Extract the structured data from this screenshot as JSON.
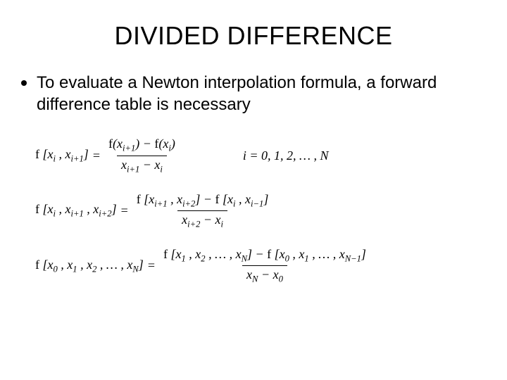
{
  "title": "DIVIDED DIFFERENCE",
  "bullet": "To evaluate a Newton interpolation formula, a forward difference table is necessary",
  "formulas": {
    "f1": {
      "lhs": "f [x_i , x_{i+1}]",
      "num": "f(x_{i+1}) − f(x_i)",
      "den": "x_{i+1} − x_i",
      "side": "i = 0, 1, 2, … , N"
    },
    "f2": {
      "lhs": "f [x_i , x_{i+1} , x_{i+2}]",
      "num": "f [x_{i+1} , x_{i+2}] − f [x_i , x_{i−1}]",
      "den": "x_{i+2} − x_i"
    },
    "f3": {
      "lhs": "f [x_0 , x_1 , x_2 , … , x_N ]",
      "num": "f [x_1 , x_2 , … , x_N ] − f [x_0 , x_1 , … , x_{N−1}]",
      "den": "x_N − x_0"
    }
  }
}
